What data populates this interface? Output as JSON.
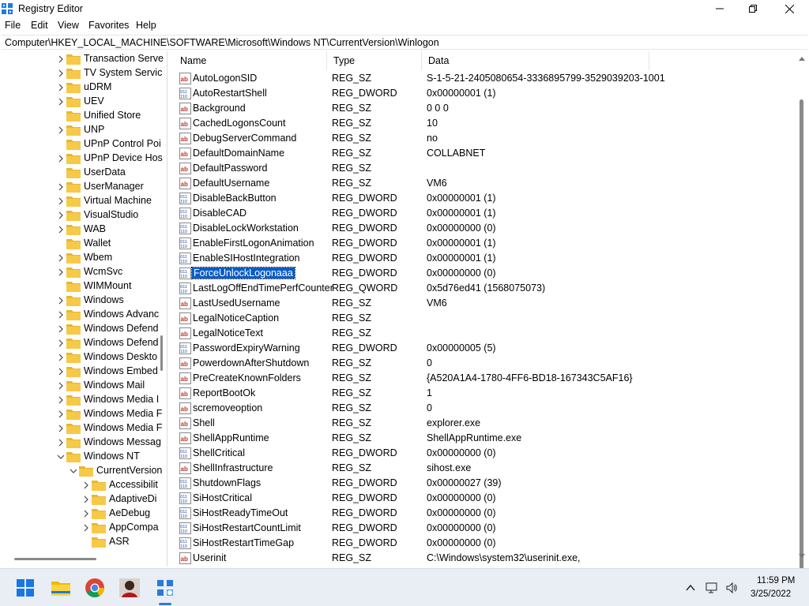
{
  "window": {
    "title": "Registry Editor"
  },
  "menu": [
    "File",
    "Edit",
    "View",
    "Favorites",
    "Help"
  ],
  "address": "Computer\\HKEY_LOCAL_MACHINE\\SOFTWARE\\Microsoft\\Windows NT\\CurrentVersion\\Winlogon",
  "tree": [
    {
      "label": "Transaction Serve",
      "chev": "right",
      "indent": 0
    },
    {
      "label": "TV System Servic",
      "chev": "right",
      "indent": 0
    },
    {
      "label": "uDRM",
      "chev": "right",
      "indent": 0
    },
    {
      "label": "UEV",
      "chev": "right",
      "indent": 0
    },
    {
      "label": "Unified Store",
      "chev": "none",
      "indent": 0
    },
    {
      "label": "UNP",
      "chev": "right",
      "indent": 0
    },
    {
      "label": "UPnP Control Poi",
      "chev": "none",
      "indent": 0
    },
    {
      "label": "UPnP Device Hos",
      "chev": "right",
      "indent": 0
    },
    {
      "label": "UserData",
      "chev": "none",
      "indent": 0
    },
    {
      "label": "UserManager",
      "chev": "right",
      "indent": 0
    },
    {
      "label": "Virtual Machine",
      "chev": "right",
      "indent": 0
    },
    {
      "label": "VisualStudio",
      "chev": "right",
      "indent": 0
    },
    {
      "label": "WAB",
      "chev": "right",
      "indent": 0
    },
    {
      "label": "Wallet",
      "chev": "none",
      "indent": 0
    },
    {
      "label": "Wbem",
      "chev": "right",
      "indent": 0
    },
    {
      "label": "WcmSvc",
      "chev": "right",
      "indent": 0
    },
    {
      "label": "WIMMount",
      "chev": "none",
      "indent": 0
    },
    {
      "label": "Windows",
      "chev": "right",
      "indent": 0
    },
    {
      "label": "Windows Advanc",
      "chev": "right",
      "indent": 0
    },
    {
      "label": "Windows Defend",
      "chev": "right",
      "indent": 0
    },
    {
      "label": "Windows Defend",
      "chev": "right",
      "indent": 0
    },
    {
      "label": "Windows Deskto",
      "chev": "right",
      "indent": 0
    },
    {
      "label": "Windows Embed",
      "chev": "right",
      "indent": 0
    },
    {
      "label": "Windows Mail",
      "chev": "right",
      "indent": 0
    },
    {
      "label": "Windows Media I",
      "chev": "right",
      "indent": 0
    },
    {
      "label": "Windows Media F",
      "chev": "right",
      "indent": 0
    },
    {
      "label": "Windows Media F",
      "chev": "right",
      "indent": 0
    },
    {
      "label": "Windows Messag",
      "chev": "right",
      "indent": 0
    },
    {
      "label": "Windows NT",
      "chev": "down",
      "indent": 0
    },
    {
      "label": "CurrentVersion",
      "chev": "down",
      "indent": 1
    },
    {
      "label": "Accessibilit",
      "chev": "right",
      "indent": 2
    },
    {
      "label": "AdaptiveDi",
      "chev": "right",
      "indent": 2
    },
    {
      "label": "AeDebug",
      "chev": "right",
      "indent": 2
    },
    {
      "label": "AppCompa",
      "chev": "right",
      "indent": 2
    },
    {
      "label": "ASR",
      "chev": "none",
      "indent": 2
    }
  ],
  "columns": {
    "name": "Name",
    "type": "Type",
    "data": "Data"
  },
  "rows": [
    {
      "name": "AutoLogonSID",
      "type": "REG_SZ",
      "data": "S-1-5-21-2405080654-3336895799-3529039203-1001",
      "kind": "sz"
    },
    {
      "name": "AutoRestartShell",
      "type": "REG_DWORD",
      "data": "0x00000001 (1)",
      "kind": "bin"
    },
    {
      "name": "Background",
      "type": "REG_SZ",
      "data": "0 0 0",
      "kind": "sz"
    },
    {
      "name": "CachedLogonsCount",
      "type": "REG_SZ",
      "data": "10",
      "kind": "sz"
    },
    {
      "name": "DebugServerCommand",
      "type": "REG_SZ",
      "data": "no",
      "kind": "sz"
    },
    {
      "name": "DefaultDomainName",
      "type": "REG_SZ",
      "data": "COLLABNET",
      "kind": "sz"
    },
    {
      "name": "DefaultPassword",
      "type": "REG_SZ",
      "data": "",
      "kind": "sz"
    },
    {
      "name": "DefaultUsername",
      "type": "REG_SZ",
      "data": "VM6",
      "kind": "sz"
    },
    {
      "name": "DisableBackButton",
      "type": "REG_DWORD",
      "data": "0x00000001 (1)",
      "kind": "bin"
    },
    {
      "name": "DisableCAD",
      "type": "REG_DWORD",
      "data": "0x00000001 (1)",
      "kind": "bin"
    },
    {
      "name": "DisableLockWorkstation",
      "type": "REG_DWORD",
      "data": "0x00000000 (0)",
      "kind": "bin"
    },
    {
      "name": "EnableFirstLogonAnimation",
      "type": "REG_DWORD",
      "data": "0x00000001 (1)",
      "kind": "bin"
    },
    {
      "name": "EnableSIHostIntegration",
      "type": "REG_DWORD",
      "data": "0x00000001 (1)",
      "kind": "bin"
    },
    {
      "name": "ForceUnlockLogonaaa",
      "type": "REG_DWORD",
      "data": "0x00000000 (0)",
      "kind": "bin",
      "selected": true
    },
    {
      "name": "LastLogOffEndTimePerfCounter",
      "type": "REG_QWORD",
      "data": "0x5d76ed41 (1568075073)",
      "kind": "bin"
    },
    {
      "name": "LastUsedUsername",
      "type": "REG_SZ",
      "data": "VM6",
      "kind": "sz"
    },
    {
      "name": "LegalNoticeCaption",
      "type": "REG_SZ",
      "data": "",
      "kind": "sz"
    },
    {
      "name": "LegalNoticeText",
      "type": "REG_SZ",
      "data": "",
      "kind": "sz"
    },
    {
      "name": "PasswordExpiryWarning",
      "type": "REG_DWORD",
      "data": "0x00000005 (5)",
      "kind": "bin"
    },
    {
      "name": "PowerdownAfterShutdown",
      "type": "REG_SZ",
      "data": "0",
      "kind": "sz"
    },
    {
      "name": "PreCreateKnownFolders",
      "type": "REG_SZ",
      "data": "{A520A1A4-1780-4FF6-BD18-167343C5AF16}",
      "kind": "sz"
    },
    {
      "name": "ReportBootOk",
      "type": "REG_SZ",
      "data": "1",
      "kind": "sz"
    },
    {
      "name": "scremoveoption",
      "type": "REG_SZ",
      "data": "0",
      "kind": "sz"
    },
    {
      "name": "Shell",
      "type": "REG_SZ",
      "data": "explorer.exe",
      "kind": "sz"
    },
    {
      "name": "ShellAppRuntime",
      "type": "REG_SZ",
      "data": "ShellAppRuntime.exe",
      "kind": "sz"
    },
    {
      "name": "ShellCritical",
      "type": "REG_DWORD",
      "data": "0x00000000 (0)",
      "kind": "bin"
    },
    {
      "name": "ShellInfrastructure",
      "type": "REG_SZ",
      "data": "sihost.exe",
      "kind": "sz"
    },
    {
      "name": "ShutdownFlags",
      "type": "REG_DWORD",
      "data": "0x00000027 (39)",
      "kind": "bin"
    },
    {
      "name": "SiHostCritical",
      "type": "REG_DWORD",
      "data": "0x00000000 (0)",
      "kind": "bin"
    },
    {
      "name": "SiHostReadyTimeOut",
      "type": "REG_DWORD",
      "data": "0x00000000 (0)",
      "kind": "bin"
    },
    {
      "name": "SiHostRestartCountLimit",
      "type": "REG_DWORD",
      "data": "0x00000000 (0)",
      "kind": "bin"
    },
    {
      "name": "SiHostRestartTimeGap",
      "type": "REG_DWORD",
      "data": "0x00000000 (0)",
      "kind": "bin"
    },
    {
      "name": "Userinit",
      "type": "REG_SZ",
      "data": "C:\\Windows\\system32\\userinit.exe,",
      "kind": "sz"
    }
  ],
  "taskbar": {
    "apps": [
      "start-icon",
      "file-explorer-icon",
      "chrome-icon",
      "user-photo-app-icon",
      "regedit-icon"
    ],
    "clock_time": "11:59 PM",
    "clock_date": "3/25/2022"
  },
  "colors": {
    "selection": "#0a5cc7",
    "folder": "#f7c948",
    "taskbar": "#e9eef5"
  }
}
